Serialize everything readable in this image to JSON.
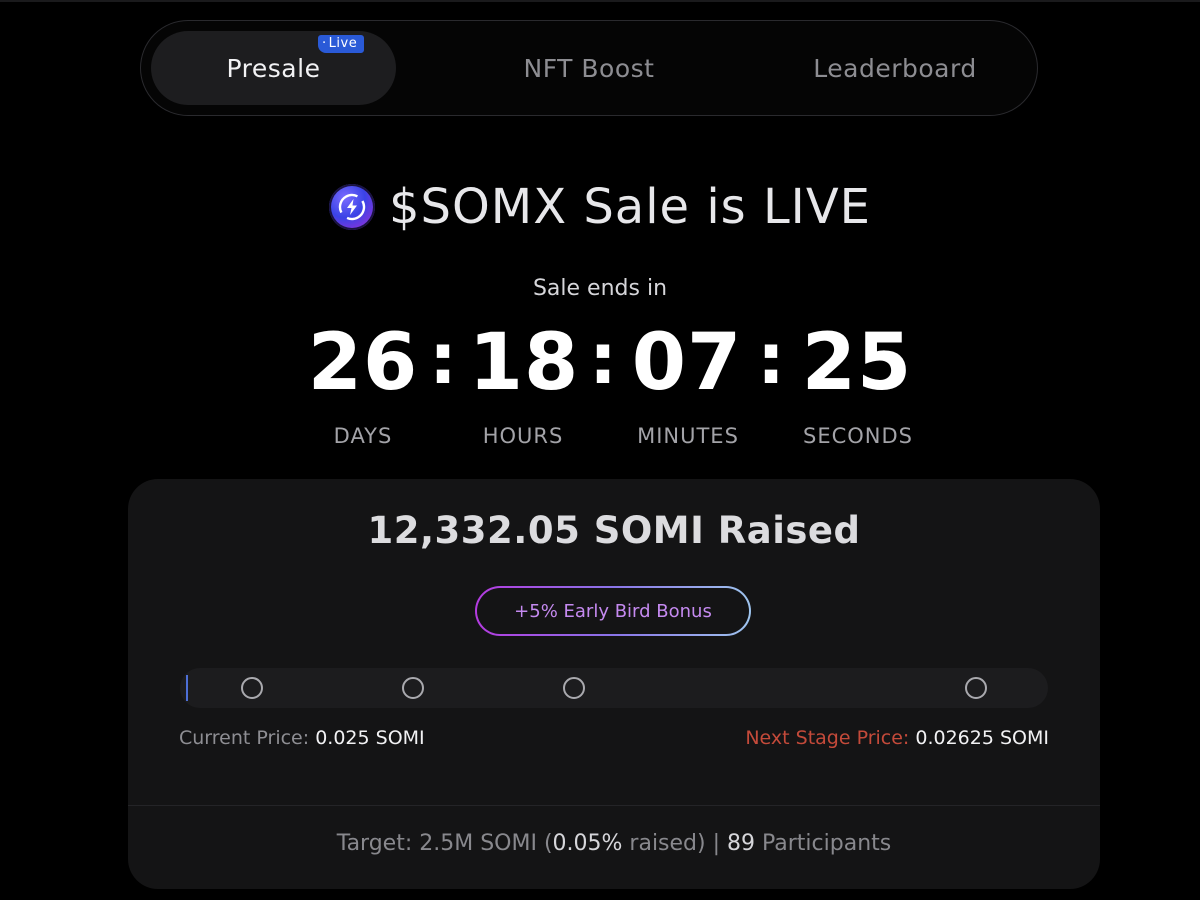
{
  "tabs": [
    {
      "label": "Presale",
      "badge": "Live",
      "active": true
    },
    {
      "label": "NFT Boost",
      "active": false
    },
    {
      "label": "Leaderboard",
      "active": false
    }
  ],
  "hero": {
    "title": "$SOMX Sale is LIVE",
    "icon": "lightning-token-icon"
  },
  "countdown": {
    "caption": "Sale ends in",
    "days": "26",
    "hours": "18",
    "minutes": "07",
    "seconds": "25",
    "separator": ":",
    "labels": {
      "days": "DAYS",
      "hours": "HOURS",
      "minutes": "MINUTES",
      "seconds": "SECONDS"
    }
  },
  "sale": {
    "raised": "12,332.05 SOMI Raised",
    "bonus": "+5% Early Bird Bonus",
    "progress_fraction": 0.0005,
    "current_price_label": "Current Price:",
    "current_price_value": "0.025 SOMI",
    "next_price_label": "Next Stage Price:",
    "next_price_value": "0.02625 SOMI",
    "target_prefix": "Target: 2.5M SOMI (",
    "target_percent": "0.05%",
    "target_mid": " raised) | ",
    "participants": "89",
    "participants_suffix": " Participants"
  },
  "colors": {
    "accent_blue": "#2a5ad7",
    "next_price": "#c44a3a",
    "bonus_gradient": [
      "#b43be0",
      "#9fc5ee"
    ]
  }
}
